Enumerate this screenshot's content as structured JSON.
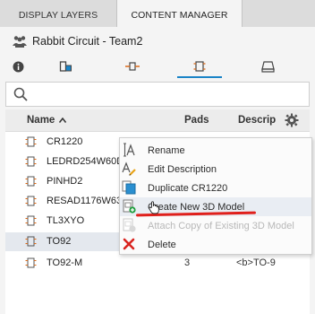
{
  "tabs": [
    "DISPLAY LAYERS",
    "CONTENT MANAGER",
    ""
  ],
  "project": {
    "title": "Rabbit Circuit - Team2"
  },
  "toolbar": {
    "icons": [
      "info-icon",
      "symbol-icon",
      "footprint-icon",
      "package-icon",
      "model-3d-icon"
    ],
    "active_index": 3
  },
  "search": {
    "placeholder": "",
    "value": ""
  },
  "table": {
    "columns": {
      "name": "Name",
      "pads": "Pads",
      "description": "Descrip"
    },
    "sort": {
      "column": "Name",
      "direction": "ascending"
    },
    "rows": [
      {
        "name": "CR1220",
        "pads": "",
        "description": ""
      },
      {
        "name": "LEDRD254W60D",
        "pads": "",
        "description": ""
      },
      {
        "name": "PINHD2",
        "pads": "",
        "description": ""
      },
      {
        "name": "RESAD1176W63",
        "pads": "",
        "description": ""
      },
      {
        "name": "TL3XYO",
        "pads": "",
        "description": ""
      },
      {
        "name": "TO92",
        "pads": "",
        "description": ""
      },
      {
        "name": "TO92-M",
        "pads": "3",
        "description": "<b>TO-9"
      }
    ]
  },
  "context_menu": {
    "items": [
      {
        "label": "Rename",
        "icon": "rename-icon",
        "enabled": true
      },
      {
        "label": "Edit Description",
        "icon": "edit-description-icon",
        "enabled": true
      },
      {
        "label": "Duplicate CR1220",
        "icon": "duplicate-icon",
        "enabled": true
      },
      {
        "label": "Create New 3D Model",
        "icon": "create-3d-model-icon",
        "enabled": true
      },
      {
        "label": "Attach Copy of Existing 3D Model",
        "icon": "attach-3d-model-icon",
        "enabled": false
      },
      {
        "label": "Delete",
        "icon": "delete-icon",
        "enabled": true
      }
    ]
  },
  "colors": {
    "accent": "#1a84c7",
    "annotation": "#e0201c",
    "delete": "#d9231f"
  }
}
